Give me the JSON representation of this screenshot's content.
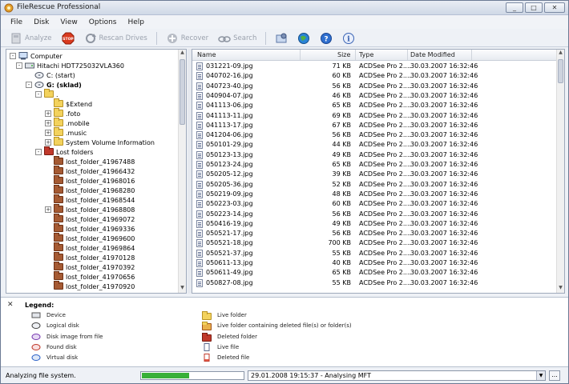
{
  "window": {
    "title": "FileRescue Professional"
  },
  "menu": [
    "File",
    "Disk",
    "View",
    "Options",
    "Help"
  ],
  "toolbar": {
    "analyze": "Analyze",
    "stop": "STOP",
    "rescan": "Rescan Drives",
    "recover": "Recover",
    "search": "Search"
  },
  "tree": [
    {
      "label": "Computer",
      "level": 0,
      "icon": "computer-icon",
      "exp": "-"
    },
    {
      "label": "Hitachi HDT725032VLA360",
      "level": 1,
      "icon": "hdd-icon",
      "exp": "-"
    },
    {
      "label": "C: (start)",
      "level": 2,
      "icon": "logical-disk-icon",
      "exp": ""
    },
    {
      "label": "G: (sklad)",
      "level": 2,
      "icon": "logical-disk-icon",
      "exp": "-",
      "bold": true
    },
    {
      "label": ".",
      "level": 3,
      "icon": "folder-icon",
      "exp": "-"
    },
    {
      "label": "$Extend",
      "level": 4,
      "icon": "folder-icon",
      "exp": ""
    },
    {
      "label": ".foto",
      "level": 4,
      "icon": "folder-icon",
      "exp": "+"
    },
    {
      "label": ".mobile",
      "level": 4,
      "icon": "folder-icon",
      "exp": "+"
    },
    {
      "label": ".music",
      "level": 4,
      "icon": "folder-icon",
      "exp": "+"
    },
    {
      "label": "System Volume Information",
      "level": 4,
      "icon": "folder-icon",
      "exp": "+"
    },
    {
      "label": "Lost folders",
      "level": 3,
      "icon": "lost-folders-icon",
      "exp": "-"
    },
    {
      "label": "lost_folder_41967488",
      "level": 4,
      "icon": "lost-folder-icon",
      "exp": ""
    },
    {
      "label": "lost_folder_41966432",
      "level": 4,
      "icon": "lost-folder-icon",
      "exp": ""
    },
    {
      "label": "lost_folder_41968016",
      "level": 4,
      "icon": "lost-folder-icon",
      "exp": ""
    },
    {
      "label": "lost_folder_41968280",
      "level": 4,
      "icon": "lost-folder-icon",
      "exp": ""
    },
    {
      "label": "lost_folder_41968544",
      "level": 4,
      "icon": "lost-folder-icon",
      "exp": ""
    },
    {
      "label": "lost_folder_41968808",
      "level": 4,
      "icon": "lost-folder-icon",
      "exp": "+"
    },
    {
      "label": "lost_folder_41969072",
      "level": 4,
      "icon": "lost-folder-icon",
      "exp": ""
    },
    {
      "label": "lost_folder_41969336",
      "level": 4,
      "icon": "lost-folder-icon",
      "exp": ""
    },
    {
      "label": "lost_folder_41969600",
      "level": 4,
      "icon": "lost-folder-icon",
      "exp": ""
    },
    {
      "label": "lost_folder_41969864",
      "level": 4,
      "icon": "lost-folder-icon",
      "exp": ""
    },
    {
      "label": "lost_folder_41970128",
      "level": 4,
      "icon": "lost-folder-icon",
      "exp": ""
    },
    {
      "label": "lost_folder_41970392",
      "level": 4,
      "icon": "lost-folder-icon",
      "exp": ""
    },
    {
      "label": "lost_folder_41970656",
      "level": 4,
      "icon": "lost-folder-icon",
      "exp": ""
    },
    {
      "label": "lost_folder_41970920",
      "level": 4,
      "icon": "lost-folder-icon",
      "exp": ""
    }
  ],
  "columns": {
    "name": "Name",
    "size": "Size",
    "type": "Type",
    "date": "Date Modified"
  },
  "files": [
    {
      "name": "031221-09.jpg",
      "size": "71 KB",
      "type": "ACDSee Pro 2....",
      "date": "30.03.2007 16:32:46"
    },
    {
      "name": "040702-16.jpg",
      "size": "60 KB",
      "type": "ACDSee Pro 2....",
      "date": "30.03.2007 16:32:46"
    },
    {
      "name": "040723-40.jpg",
      "size": "56 KB",
      "type": "ACDSee Pro 2....",
      "date": "30.03.2007 16:32:46"
    },
    {
      "name": "040904-07.jpg",
      "size": "46 KB",
      "type": "ACDSee Pro 2....",
      "date": "30.03.2007 16:32:46"
    },
    {
      "name": "041113-06.jpg",
      "size": "65 KB",
      "type": "ACDSee Pro 2....",
      "date": "30.03.2007 16:32:46"
    },
    {
      "name": "041113-11.jpg",
      "size": "69 KB",
      "type": "ACDSee Pro 2....",
      "date": "30.03.2007 16:32:46"
    },
    {
      "name": "041113-17.jpg",
      "size": "67 KB",
      "type": "ACDSee Pro 2....",
      "date": "30.03.2007 16:32:46"
    },
    {
      "name": "041204-06.jpg",
      "size": "56 KB",
      "type": "ACDSee Pro 2....",
      "date": "30.03.2007 16:32:46"
    },
    {
      "name": "050101-29.jpg",
      "size": "44 KB",
      "type": "ACDSee Pro 2....",
      "date": "30.03.2007 16:32:46"
    },
    {
      "name": "050123-13.jpg",
      "size": "49 KB",
      "type": "ACDSee Pro 2....",
      "date": "30.03.2007 16:32:46"
    },
    {
      "name": "050123-24.jpg",
      "size": "65 KB",
      "type": "ACDSee Pro 2....",
      "date": "30.03.2007 16:32:46"
    },
    {
      "name": "050205-12.jpg",
      "size": "39 KB",
      "type": "ACDSee Pro 2....",
      "date": "30.03.2007 16:32:46"
    },
    {
      "name": "050205-36.jpg",
      "size": "52 KB",
      "type": "ACDSee Pro 2....",
      "date": "30.03.2007 16:32:46"
    },
    {
      "name": "050219-09.jpg",
      "size": "48 KB",
      "type": "ACDSee Pro 2....",
      "date": "30.03.2007 16:32:46"
    },
    {
      "name": "050223-03.jpg",
      "size": "60 KB",
      "type": "ACDSee Pro 2....",
      "date": "30.03.2007 16:32:46"
    },
    {
      "name": "050223-14.jpg",
      "size": "56 KB",
      "type": "ACDSee Pro 2....",
      "date": "30.03.2007 16:32:46"
    },
    {
      "name": "050416-19.jpg",
      "size": "49 KB",
      "type": "ACDSee Pro 2....",
      "date": "30.03.2007 16:32:46"
    },
    {
      "name": "050521-17.jpg",
      "size": "56 KB",
      "type": "ACDSee Pro 2....",
      "date": "30.03.2007 16:32:46"
    },
    {
      "name": "050521-18.jpg",
      "size": "700 KB",
      "type": "ACDSee Pro 2....",
      "date": "30.03.2007 16:32:46"
    },
    {
      "name": "050521-37.jpg",
      "size": "55 KB",
      "type": "ACDSee Pro 2....",
      "date": "30.03.2007 16:32:46"
    },
    {
      "name": "050611-13.jpg",
      "size": "40 KB",
      "type": "ACDSee Pro 2....",
      "date": "30.03.2007 16:32:46"
    },
    {
      "name": "050611-49.jpg",
      "size": "65 KB",
      "type": "ACDSee Pro 2....",
      "date": "30.03.2007 16:32:46"
    },
    {
      "name": "050827-08.jpg",
      "size": "55 KB",
      "type": "ACDSee Pro 2....",
      "date": "30.03.2007 16:32:46"
    }
  ],
  "legend": {
    "title": "Legend:",
    "left": [
      {
        "label": "Device",
        "icon": "device-icon"
      },
      {
        "label": "Logical disk",
        "icon": "logical-disk-icon"
      },
      {
        "label": "Disk image from file",
        "icon": "disk-image-icon"
      },
      {
        "label": "Found disk",
        "icon": "found-disk-icon"
      },
      {
        "label": "Virtual disk",
        "icon": "virtual-disk-icon"
      }
    ],
    "right": [
      {
        "label": "Live folder",
        "icon": "live-folder-icon"
      },
      {
        "label": "Live folder containing deleted file(s) or folder(s)",
        "icon": "live-folder-deleted-icon"
      },
      {
        "label": "Deleted folder",
        "icon": "deleted-folder-icon"
      },
      {
        "label": "Live file",
        "icon": "live-file-icon"
      },
      {
        "label": "Deleted file",
        "icon": "deleted-file-icon"
      }
    ]
  },
  "status": {
    "text": "Analyzing file system.",
    "progress": 0.47,
    "log": "29.01.2008 19:15:37 - Analysing MFT",
    "more": "..."
  },
  "colors": {
    "progress": "#38b038",
    "deleted": "#c0392b",
    "folder": "#f3d25d"
  }
}
